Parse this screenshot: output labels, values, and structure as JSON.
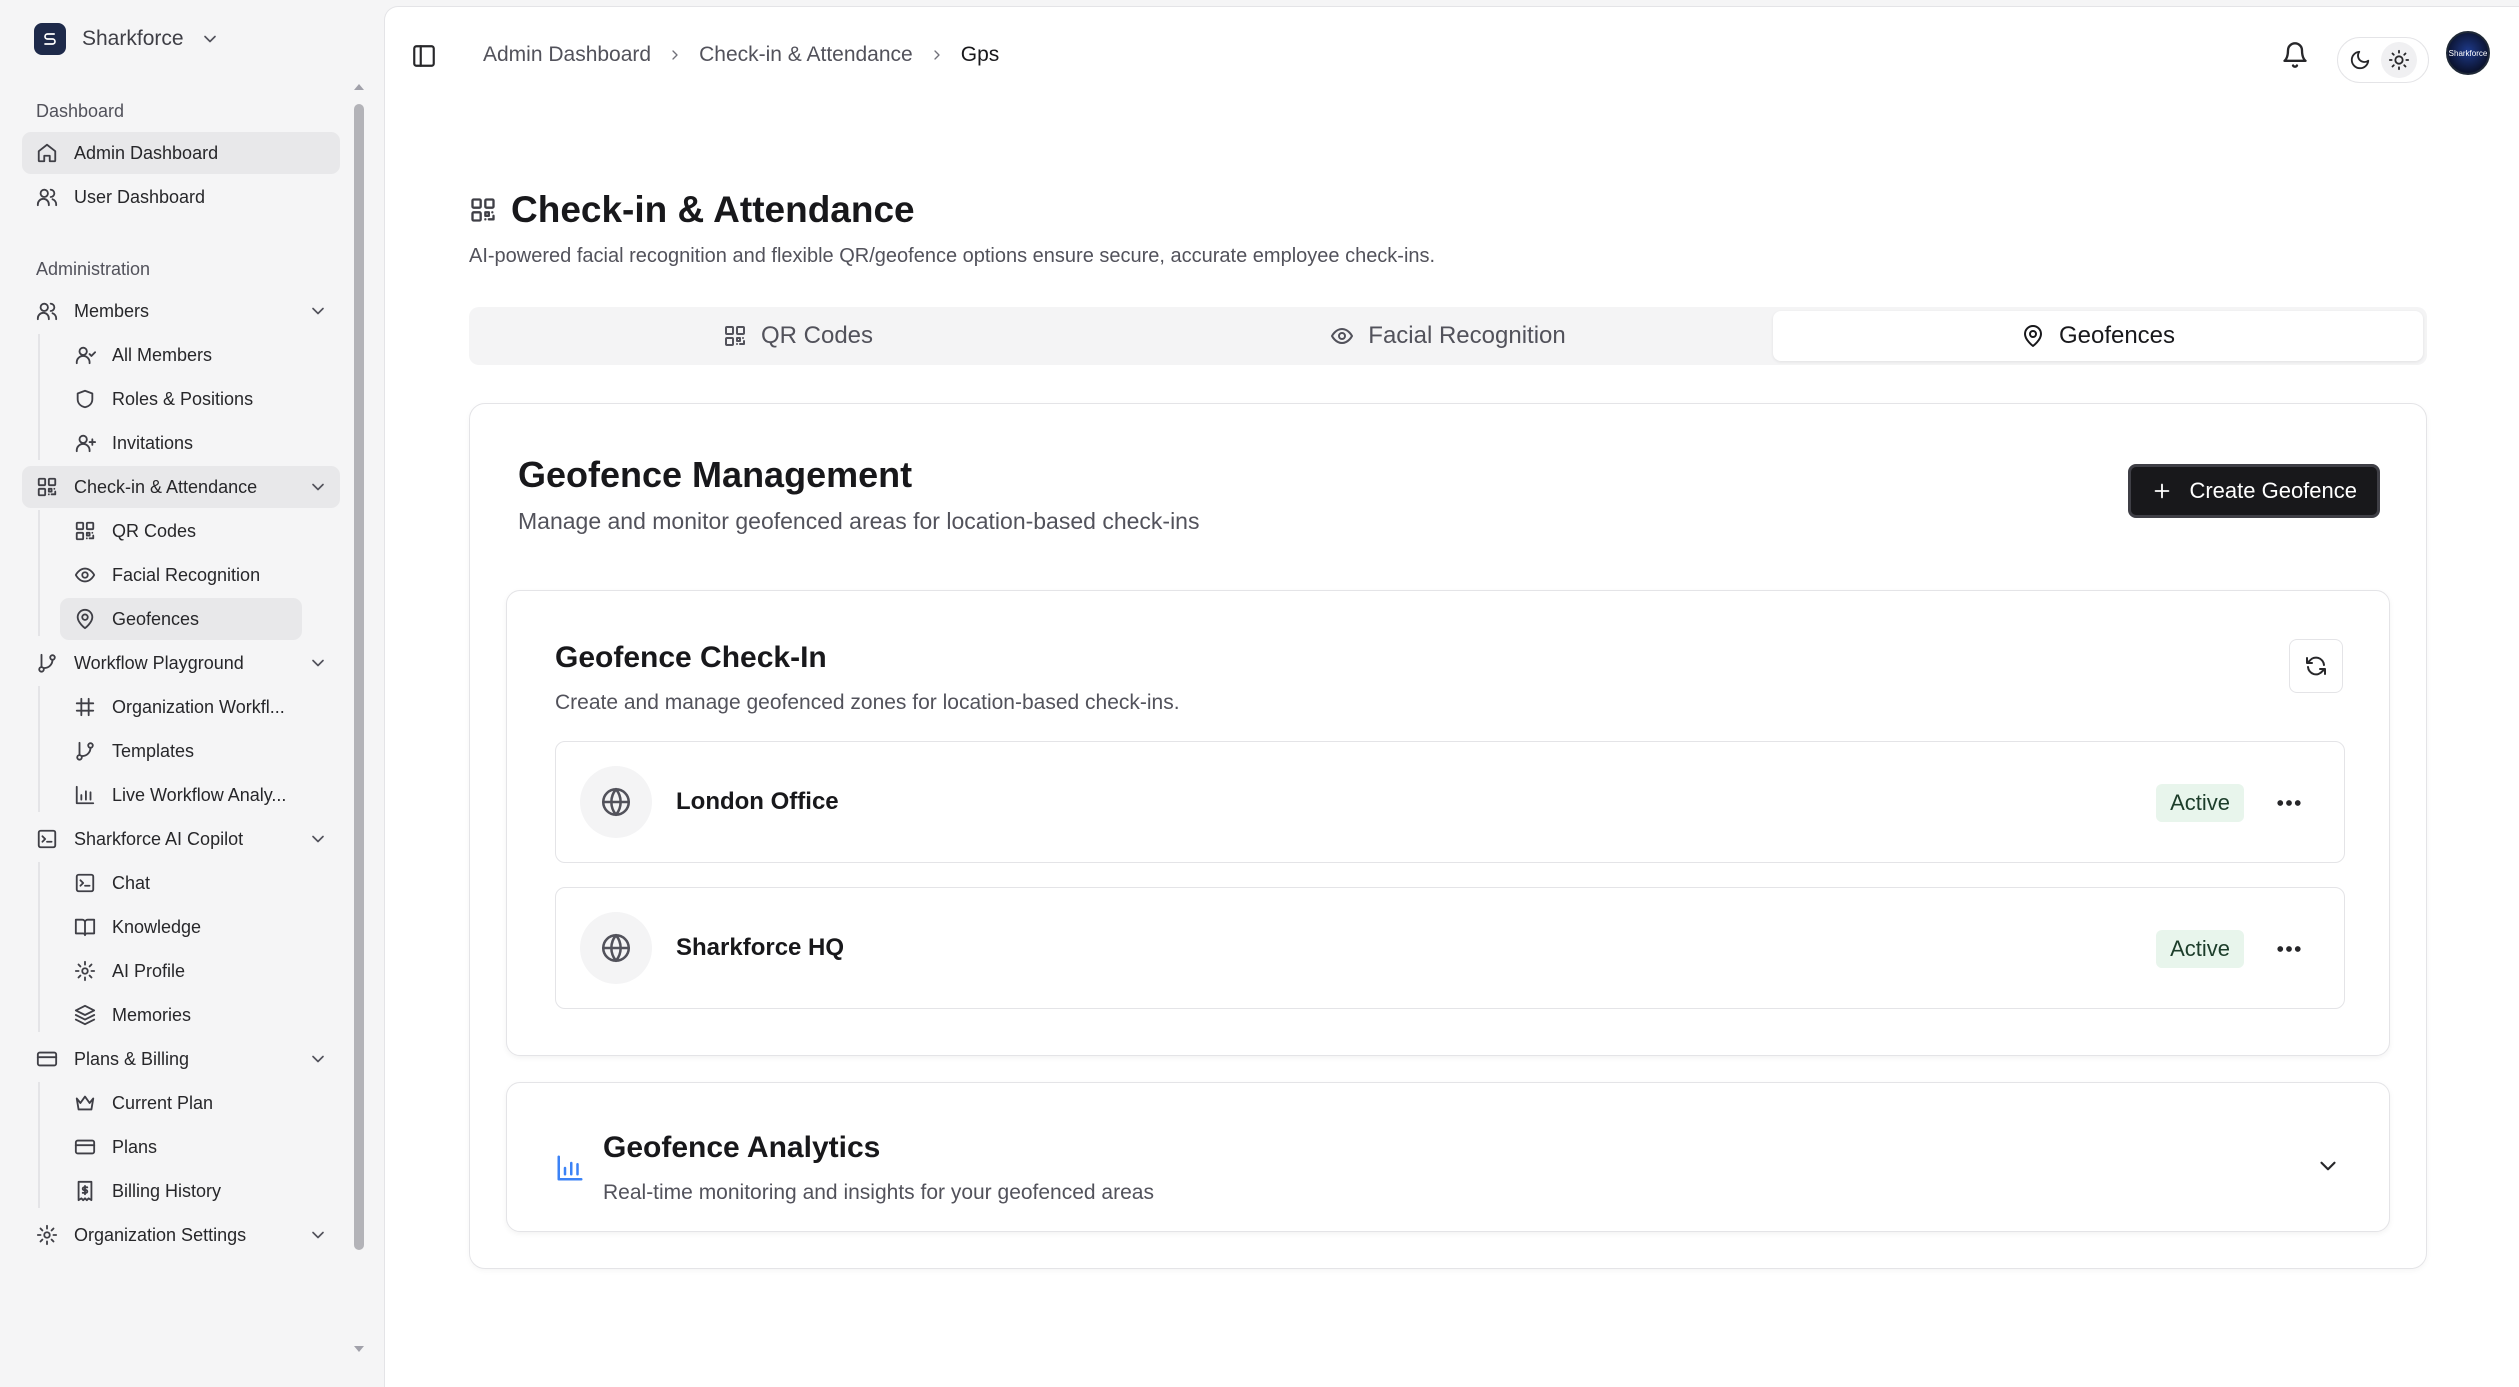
{
  "org": {
    "name": "Sharkforce"
  },
  "sidebar": {
    "dashboard_label": "Dashboard",
    "admin_dashboard": "Admin Dashboard",
    "user_dashboard": "User Dashboard",
    "administration_label": "Administration",
    "members": "Members",
    "all_members": "All Members",
    "roles_positions": "Roles & Positions",
    "invitations": "Invitations",
    "checkin": "Check-in & Attendance",
    "qr_codes": "QR Codes",
    "facial_recognition": "Facial Recognition",
    "geofences": "Geofences",
    "workflow_playground": "Workflow Playground",
    "organization_workflows": "Organization Workfl...",
    "templates": "Templates",
    "live_workflow_analytics": "Live Workflow Analy...",
    "copilot": "Sharkforce AI Copilot",
    "chat": "Chat",
    "knowledge": "Knowledge",
    "ai_profile": "AI Profile",
    "memories": "Memories",
    "plans_billing": "Plans & Billing",
    "current_plan": "Current Plan",
    "plans": "Plans",
    "billing_history": "Billing History",
    "organization_settings": "Organization Settings"
  },
  "breadcrumb": [
    "Admin Dashboard",
    "Check-in & Attendance",
    "Gps"
  ],
  "avatar_text": "Sharkforce",
  "page": {
    "title": "Check-in & Attendance",
    "description": "AI-powered facial recognition and flexible QR/geofence options ensure secure, accurate employee check-ins."
  },
  "tabs": [
    {
      "label": "QR Codes",
      "icon": "qr-code-icon",
      "active": false
    },
    {
      "label": "Facial Recognition",
      "icon": "eye-icon",
      "active": false
    },
    {
      "label": "Geofences",
      "icon": "map-pin-icon",
      "active": true
    }
  ],
  "management": {
    "title": "Geofence Management",
    "description": "Manage and monitor geofenced areas for location-based check-ins",
    "create_button": "Create Geofence"
  },
  "checkin": {
    "title": "Geofence Check-In",
    "description": "Create and manage geofenced zones for location-based check-ins.",
    "geofences": [
      {
        "name": "London Office",
        "status": "Active"
      },
      {
        "name": "Sharkforce HQ",
        "status": "Active"
      }
    ]
  },
  "analytics": {
    "title": "Geofence Analytics",
    "description": "Real-time monitoring and insights for your geofenced areas"
  },
  "colors": {
    "accent_dark": "#18181b",
    "badge_bg": "#e8f5ec",
    "analytics_icon": "#3b82f6"
  }
}
